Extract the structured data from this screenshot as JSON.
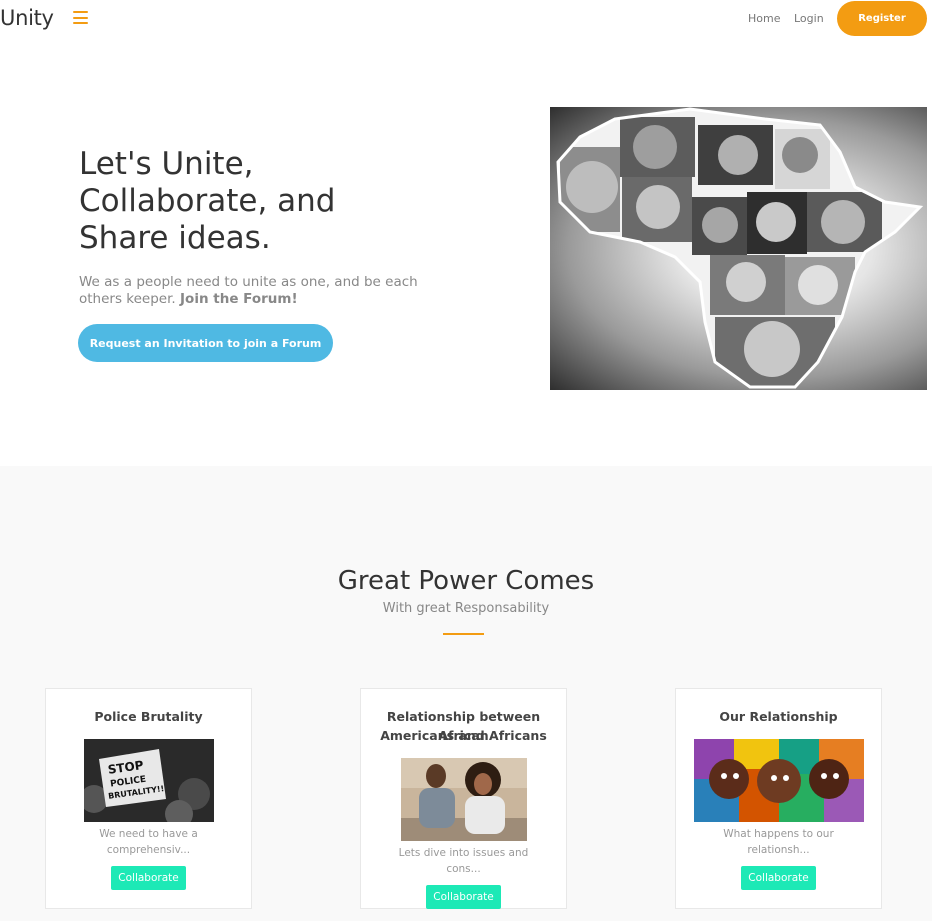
{
  "nav": {
    "brand": "Unity",
    "home": "Home",
    "login": "Login",
    "register": "Register"
  },
  "hero": {
    "title": "Let's Unite, Collaborate, and Share ideas.",
    "subtitle": "We as a people need to unite as one, and be each others keeper.",
    "subtitle_bold": "Join the Forum!",
    "cta": "Request an Invitation to join a Forum"
  },
  "feature": {
    "title": "Great Power Comes",
    "subtitle": "With great Responsability"
  },
  "cards": [
    {
      "title": "Police Brutality",
      "sign_line1": "STOP",
      "sign_line2": "POLICE",
      "sign_line3": "BRUTALITY!!",
      "desc_line1": "We need to have a",
      "desc_line2": "comprehensiv...",
      "button": "Collaborate"
    },
    {
      "title_line1": "Relationship between African",
      "title_line2": "Americans and Africans",
      "desc_line1": "Lets dive into issues and",
      "desc_line2": "cons...",
      "button": "Collaborate"
    },
    {
      "title": "Our Relationship",
      "desc_line1": "What happens to our",
      "desc_line2": "relationsh...",
      "button": "Collaborate"
    }
  ],
  "colors": {
    "accent": "#f39c12",
    "cta_blue": "#4fb9e3",
    "collab_green": "#1de9b6",
    "section_bg": "#f9f9f9"
  },
  "icons": {
    "menu": "hamburger-menu-icon"
  }
}
